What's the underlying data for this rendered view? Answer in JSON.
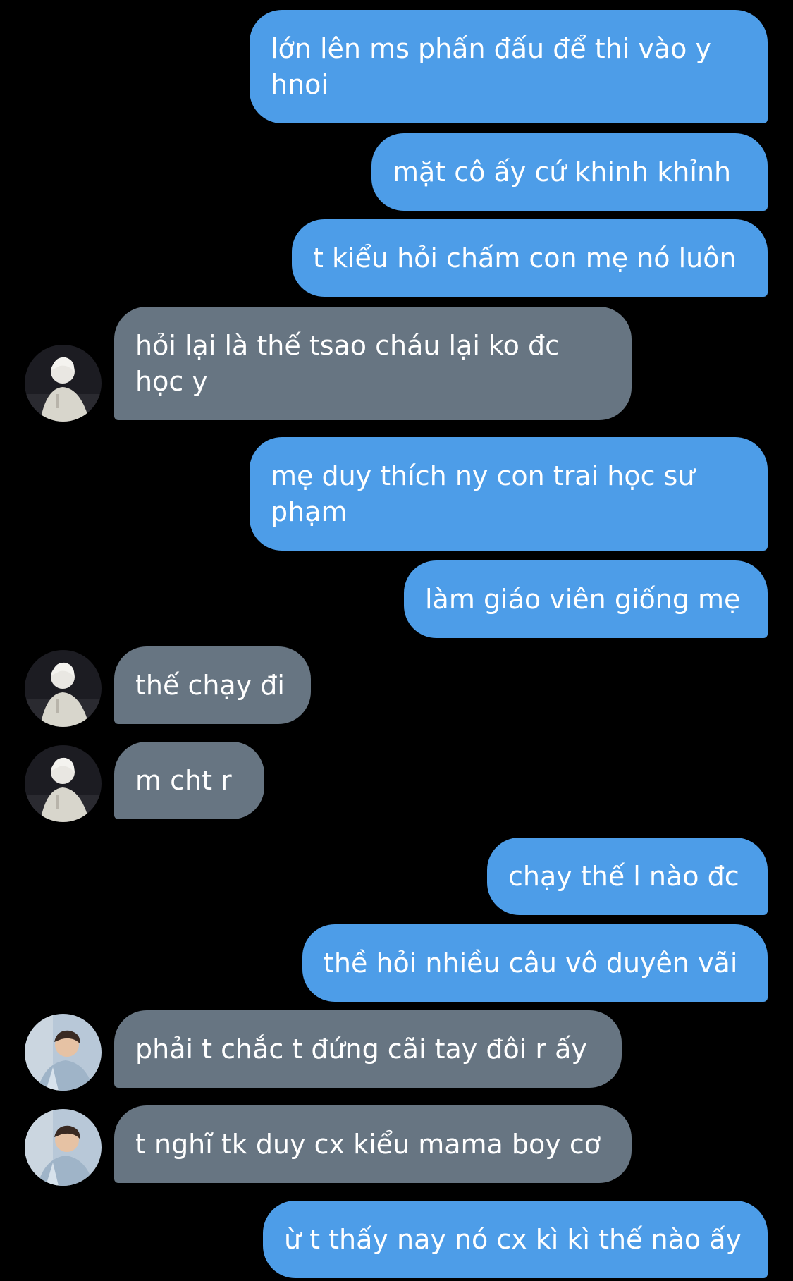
{
  "colors": {
    "background": "#000000",
    "outgoing_bubble": "#4d9de8",
    "incoming_bubble": "#677582",
    "text": "#ffffff"
  },
  "messages": [
    {
      "direction": "out",
      "text": "lớn lên ms phấn đấu để thi vào y\nhnoi"
    },
    {
      "direction": "out",
      "text": "mặt cô ấy cứ khinh khỉnh"
    },
    {
      "direction": "out",
      "text": "t kiểu hỏi chấm con mẹ nó luôn"
    },
    {
      "direction": "in",
      "avatar": "avatar-white-hair-icon",
      "text": "hỏi lại là thế tsao cháu lại ko đc\nhọc y"
    },
    {
      "direction": "out",
      "text": "mẹ duy thích ny con trai học sư\nphạm"
    },
    {
      "direction": "out",
      "text": "làm giáo viên giống mẹ"
    },
    {
      "direction": "in",
      "avatar": "avatar-white-hair-icon",
      "text": "thế chạy đi"
    },
    {
      "direction": "in",
      "avatar": "avatar-white-hair-icon",
      "text": "m cht r"
    },
    {
      "direction": "out",
      "text": "chạy thế l nào đc"
    },
    {
      "direction": "out",
      "text": "thề hỏi nhiều câu vô duyên vãi"
    },
    {
      "direction": "in",
      "avatar": "avatar-dark-hair-icon",
      "text": "phải t chắc t đứng cãi tay đôi r ấy"
    },
    {
      "direction": "in",
      "avatar": "avatar-dark-hair-icon",
      "text": "t nghĩ tk duy cx kiểu mama boy cơ"
    },
    {
      "direction": "out",
      "text": "ừ t thấy nay nó cx kì kì thế nào ấy"
    }
  ]
}
